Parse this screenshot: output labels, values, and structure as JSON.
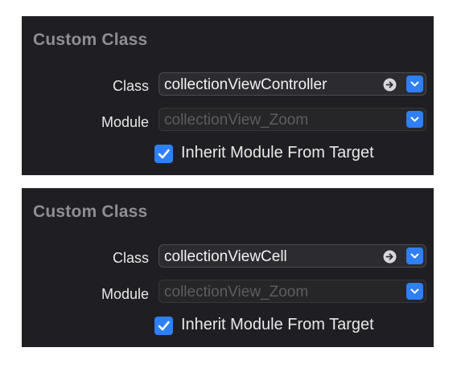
{
  "panels": [
    {
      "section_title": "Custom Class",
      "class_label": "Class",
      "class_value": "collectionViewController",
      "module_label": "Module",
      "module_placeholder": "collectionView_Zoom",
      "inherit_label": "Inherit Module From Target",
      "inherit_checked": true
    },
    {
      "section_title": "Custom Class",
      "class_label": "Class",
      "class_value": "collectionViewCell",
      "module_label": "Module",
      "module_placeholder": "collectionView_Zoom",
      "inherit_label": "Inherit Module From Target",
      "inherit_checked": true
    }
  ],
  "icons": {
    "goto": "arrow-right-circle-icon",
    "dropdown": "chevron-down-icon",
    "checkbox": "checkmark-icon"
  },
  "colors": {
    "panel_background": "#1f1f23",
    "accent": "#2f7ff6",
    "title_text": "#8e8e93",
    "label_text": "#e8e8ea",
    "placeholder_text": "#5c5c61"
  }
}
